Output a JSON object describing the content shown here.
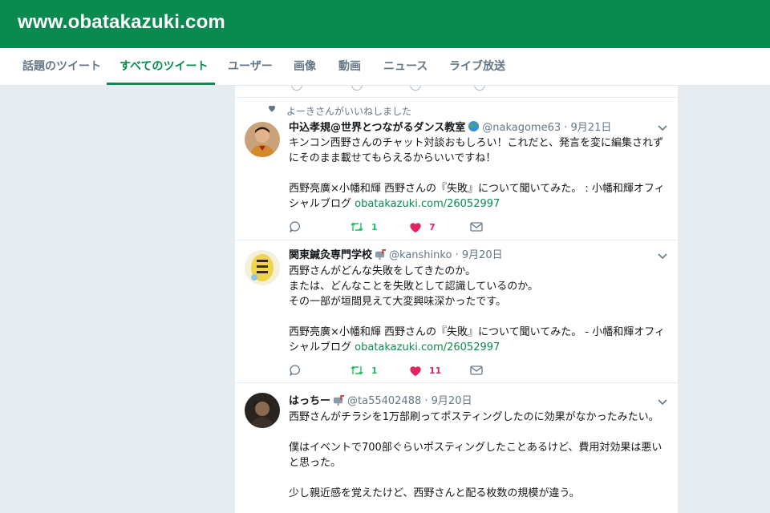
{
  "site": {
    "title": "www.obatakazuki.com"
  },
  "colors": {
    "brand": "#0b8a4f",
    "like": "#e0245e",
    "retweet": "#17bf63",
    "muted": "#657786"
  },
  "tabs": [
    {
      "label": "話題のツイート"
    },
    {
      "label": "すべてのツイート",
      "active": true
    },
    {
      "label": "ユーザー"
    },
    {
      "label": "画像"
    },
    {
      "label": "動画"
    },
    {
      "label": "ニュース"
    },
    {
      "label": "ライブ放送"
    }
  ],
  "tweets": [
    {
      "context": "よーきさんがいいねしました",
      "name": "中込孝規@世界とつながるダンス教室",
      "handle": "@nakagome63",
      "date": "9月21日",
      "lines": [
        "キンコン西野さんのチャット対談おもしろい！これだと、発言を変に編集されず",
        "にそのまま載せてもらえるからいいですね！",
        "",
        "西野亮廣×小幡和輝 西野さんの『失敗』について聞いてみた。 : 小幡和輝オフィ"
      ],
      "last_line_prefix": "シャルブログ ",
      "link": "obatakazuki.com/26052997",
      "retweets": "1",
      "likes": "7"
    },
    {
      "name": "関東鍼灸専門学校",
      "handle": "@kanshinko",
      "date": "9月20日",
      "lines": [
        "西野さんがどんな失敗をしてきたのか。",
        "または、どんなことを失敗として認識しているのか。",
        "その一部が垣間見えて大変興味深かったです。",
        "",
        "西野亮廣×小幡和輝 西野さんの『失敗』について聞いてみた。 - 小幡和輝オフィ"
      ],
      "last_line_prefix": "シャルブログ ",
      "link": "obatakazuki.com/26052997",
      "retweets": "1",
      "likes": "11"
    },
    {
      "name": "はっちー",
      "handle": "@ta55402488",
      "date": "9月20日",
      "lines": [
        "西野さんがチラシを1万部刷ってポスティングしたのに効果がなかったみたい。",
        "",
        "僕はイベントで700部ぐらいポスティングしたことあるけど、費用対効果は悪い",
        "と思った。",
        "",
        "少し親近感を覚えたけど、西野さんと配る枚数の規模が違う。"
      ]
    }
  ]
}
